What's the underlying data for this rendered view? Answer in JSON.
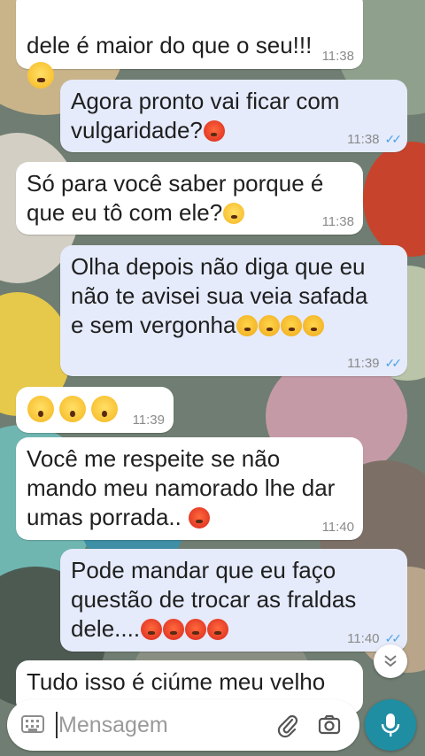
{
  "colors": {
    "incoming_bubble": "#ffffff",
    "outgoing_bubble": "#e5ebfb",
    "read_ticks": "#4fa3e8",
    "mic_button": "#1f8ea3"
  },
  "messages": [
    {
      "direction": "in",
      "text": "dele é maior do que o seu!!!",
      "emojis": [
        "grinning-face"
      ],
      "time": "11:38"
    },
    {
      "direction": "out",
      "text": "Agora pronto vai ficar com\nvulgaridade?",
      "emojis": [
        "angry-face"
      ],
      "time": "11:38",
      "status": "read"
    },
    {
      "direction": "in",
      "text": "Só para você saber porque é\nque eu tô com ele?",
      "emojis": [
        "smirking-face"
      ],
      "time": "11:38"
    },
    {
      "direction": "out",
      "text": "Olha depois não diga que eu\nnão te avisei sua  veia  safada\ne sem vergonha",
      "emojis": [
        "steam-face",
        "steam-face",
        "steam-face",
        "steam-face"
      ],
      "time": "11:39",
      "status": "read"
    },
    {
      "direction": "in",
      "text": "",
      "emojis": [
        "astonished-face",
        "astonished-face",
        "astonished-face"
      ],
      "time": "11:39"
    },
    {
      "direction": "in",
      "text": "Você me respeite se não\nmando meu namorado lhe dar\numas porrada.. ",
      "emojis": [
        "angry-face"
      ],
      "time": "11:40"
    },
    {
      "direction": "out",
      "text": "Pode mandar que eu faço\nquestão de trocar as fraldas\ndele....",
      "emojis": [
        "angry-face",
        "angry-face",
        "angry-face",
        "angry-face"
      ],
      "time": "11:40",
      "status": "read"
    },
    {
      "direction": "in",
      "text": "Tudo isso é ciúme meu velho",
      "emojis": [],
      "time": ""
    }
  ],
  "composer": {
    "placeholder": "Mensagem",
    "keyboard_icon": "keyboard-icon",
    "attach_icon": "paperclip-icon",
    "camera_icon": "camera-icon",
    "mic_icon": "microphone-icon"
  },
  "scroll_button_icon": "double-chevron-down-icon"
}
